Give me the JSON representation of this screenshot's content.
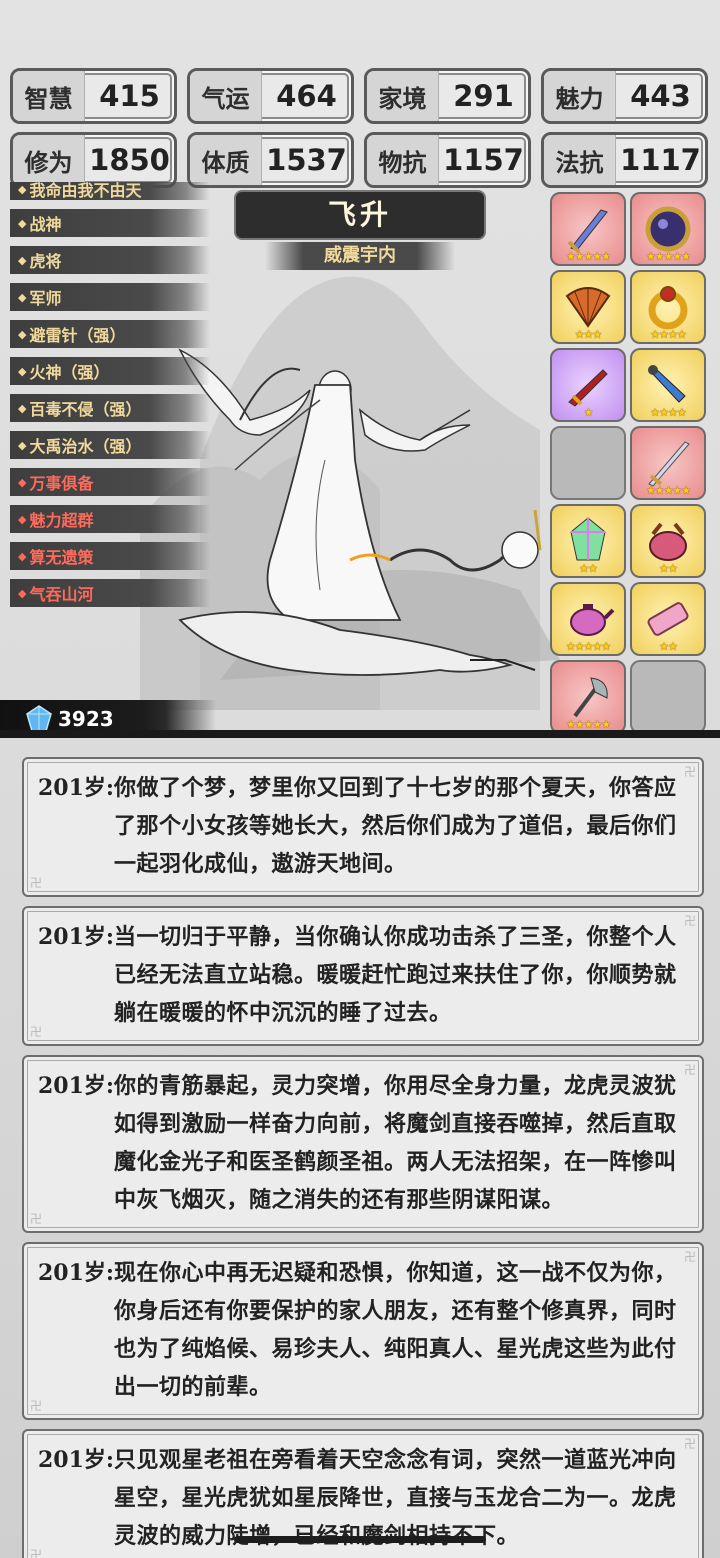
{
  "stats": {
    "row1": [
      {
        "label": "智慧",
        "value": "415"
      },
      {
        "label": "气运",
        "value": "464"
      },
      {
        "label": "家境",
        "value": "291"
      },
      {
        "label": "魅力",
        "value": "443"
      }
    ],
    "row2": [
      {
        "label": "修为",
        "value": "1850"
      },
      {
        "label": "体质",
        "value": "1537"
      },
      {
        "label": "物抗",
        "value": "1157"
      },
      {
        "label": "法抗",
        "value": "1117"
      }
    ]
  },
  "skills": [
    {
      "label": "我命由我不由天",
      "color": "gold"
    },
    {
      "label": "战神",
      "color": "gold"
    },
    {
      "label": "虎将",
      "color": "gold"
    },
    {
      "label": "军师",
      "color": "gold"
    },
    {
      "label": "避雷针（强）",
      "color": "gold"
    },
    {
      "label": "火神（强）",
      "color": "gold"
    },
    {
      "label": "百毒不侵（强）",
      "color": "gold"
    },
    {
      "label": "大禹治水（强）",
      "color": "gold"
    },
    {
      "label": "万事俱备",
      "color": "red"
    },
    {
      "label": "魅力超群",
      "color": "red"
    },
    {
      "label": "算无遗策",
      "color": "red"
    },
    {
      "label": "气吞山河",
      "color": "red"
    }
  ],
  "title": {
    "main": "飞升",
    "sub": "威震宇内"
  },
  "items": [
    {
      "icon": "sword-icon",
      "rarity": "red",
      "stars": "★★★★★"
    },
    {
      "icon": "mirror-icon",
      "rarity": "red",
      "stars": "★★★★★"
    },
    {
      "icon": "fan-icon",
      "rarity": "gold",
      "stars": "★★★"
    },
    {
      "icon": "ring-icon",
      "rarity": "gold",
      "stars": "★★★★"
    },
    {
      "icon": "blade-icon",
      "rarity": "purple",
      "stars": "★"
    },
    {
      "icon": "dagger-icon",
      "rarity": "gold",
      "stars": "★★★★"
    },
    {
      "icon": "empty-slot",
      "rarity": "empty",
      "stars": ""
    },
    {
      "icon": "longsword-icon",
      "rarity": "red",
      "stars": "★★★★★"
    },
    {
      "icon": "crystal-icon",
      "rarity": "gold",
      "stars": "★★"
    },
    {
      "icon": "cauldron-icon",
      "rarity": "gold",
      "stars": "★★"
    },
    {
      "icon": "teapot-icon",
      "rarity": "gold",
      "stars": "★★★★★"
    },
    {
      "icon": "scroll-icon",
      "rarity": "gold",
      "stars": "★★"
    },
    {
      "icon": "axe-icon",
      "rarity": "red",
      "stars": "★★★★★"
    },
    {
      "icon": "empty-slot",
      "rarity": "empty",
      "stars": ""
    }
  ],
  "gems": {
    "count": "3923"
  },
  "log": [
    {
      "age": "201岁:",
      "text": "你做了个梦，梦里你又回到了十七岁的那个夏天，你答应了那个小女孩等她长大，然后你们成为了道侣，最后你们一起羽化成仙，遨游天地间。"
    },
    {
      "age": "201岁:",
      "text": "当一切归于平静，当你确认你成功击杀了三圣，你整个人已经无法直立站稳。暖暖赶忙跑过来扶住了你，你顺势就躺在暖暖的怀中沉沉的睡了过去。"
    },
    {
      "age": "201岁:",
      "text": "你的青筋暴起，灵力突增，你用尽全身力量，龙虎灵波犹如得到激励一样奋力向前，将魔剑直接吞噬掉，然后直取魔化金光子和医圣鹤颜圣祖。两人无法招架，在一阵惨叫中灰飞烟灭，随之消失的还有那些阴谋阳谋。"
    },
    {
      "age": "201岁:",
      "text": "现在你心中再无迟疑和恐惧，你知道，这一战不仅为你，你身后还有你要保护的家人朋友，还有整个修真界，同时也为了纯焰候、易珍夫人、纯阳真人、星光虎这些为此付出一切的前辈。"
    },
    {
      "age": "201岁:",
      "text": "只见观星老祖在旁看着天空念念有词，突然一道蓝光冲向星空，星光虎犹如星辰降世，直接与玉龙合二为一。龙虎灵波的威力陡增，已经和魔剑相持不下。"
    }
  ]
}
